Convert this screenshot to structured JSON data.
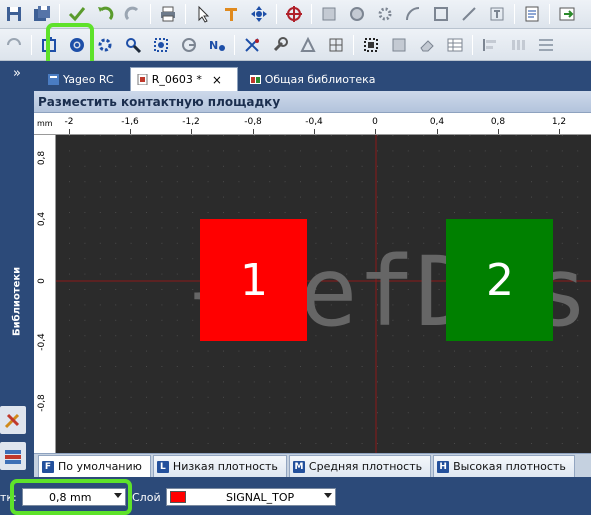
{
  "tabs": [
    {
      "label": "Yageo RC",
      "active": false,
      "icon": "book-icon"
    },
    {
      "label": "R_0603 *",
      "active": true,
      "icon": "document-icon",
      "close": "×"
    },
    {
      "label": "Общая библиотека",
      "active": false,
      "icon": "library-icon"
    }
  ],
  "left_panel": {
    "expand": "»",
    "label": "Библиотеки"
  },
  "panel": {
    "title": "Разместить контактную площадку"
  },
  "ruler": {
    "unit": "mm",
    "x_labels": [
      "-2",
      "-1,6",
      "-1,2",
      "-0,8",
      "-0,4",
      "0",
      "0,4",
      "0,8",
      "1,2"
    ],
    "y_labels": [
      "0,8",
      "0,4",
      "0",
      "-0,4",
      "-0,8"
    ]
  },
  "canvas": {
    "watermark": "{RefDes}",
    "pads": [
      {
        "label": "1",
        "color": "#ff0000"
      },
      {
        "label": "2",
        "color": "#008000"
      }
    ]
  },
  "density_tabs": [
    {
      "letter": "F",
      "label": "По умолчанию",
      "active": true
    },
    {
      "letter": "L",
      "label": "Низкая плотность",
      "active": false
    },
    {
      "letter": "M",
      "label": "Средняя плотность",
      "active": false
    },
    {
      "letter": "H",
      "label": "Высокая плотность",
      "active": false
    }
  ],
  "status": {
    "grid_label": "тк:",
    "grid_value": "0,8 mm",
    "layer_label": "Слой",
    "layer_value": "SIGNAL_TOP",
    "layer_color": "#ff0000"
  },
  "colors": {
    "accent": "#2c4a79",
    "highlight": "#5ee22a",
    "canvas": "#2b2b2b"
  }
}
